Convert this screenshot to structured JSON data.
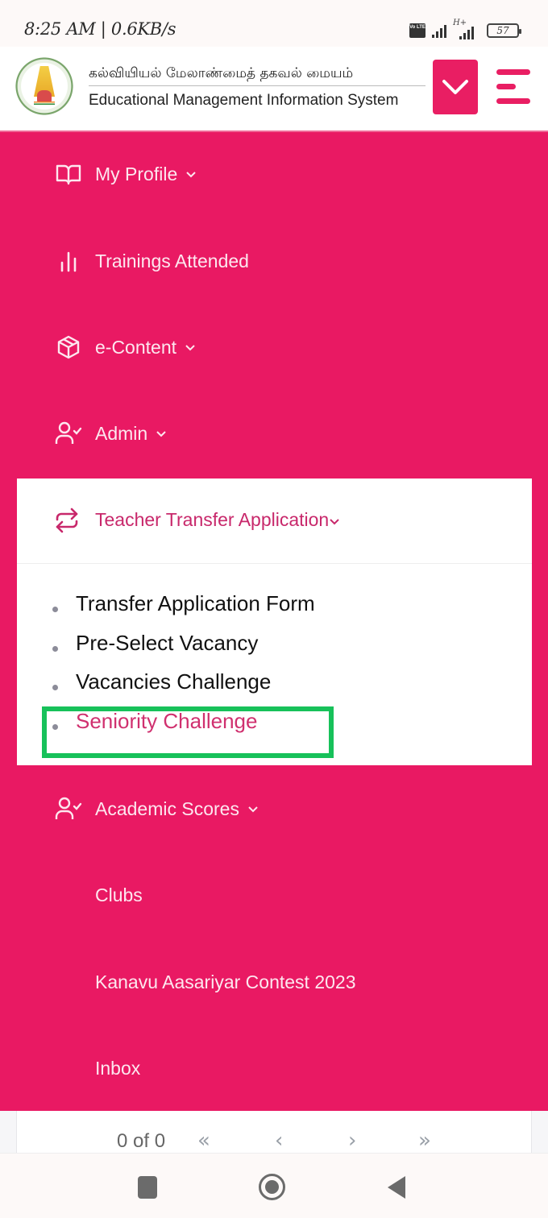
{
  "status_bar": {
    "time_speed": "8:25 AM | 0.6KB/s",
    "volte_label": "Vo LTE",
    "network_type": "H+",
    "battery_level": "57"
  },
  "header": {
    "logo_icon": "tamil-nadu-emblem",
    "title_tamil": "கல்வியியல் மேலாண்மைத் தகவல் மையம்",
    "title_english": "Educational Management Information System",
    "dropdown_icon": "chevron-down-icon",
    "menu_icon": "hamburger-icon"
  },
  "colors": {
    "brand_pink": "#e91963",
    "active_text": "#d0306f",
    "highlight_green": "#17c15a"
  },
  "menu": {
    "items": [
      {
        "label": "My Profile",
        "icon": "book-open-icon",
        "has_caret": true
      },
      {
        "label": "Trainings Attended",
        "icon": "bar-chart-icon",
        "has_caret": false
      },
      {
        "label": "e-Content",
        "icon": "package-icon",
        "has_caret": true
      },
      {
        "label": "Admin",
        "icon": "user-check-icon",
        "has_caret": true
      }
    ],
    "expanded": {
      "label": "Teacher Transfer Application",
      "icon": "repeat-icon",
      "has_caret": true,
      "children": [
        {
          "label": "Transfer Application Form",
          "active": false
        },
        {
          "label": "Pre-Select Vacancy",
          "active": false
        },
        {
          "label": "Vacancies Challenge",
          "active": false
        },
        {
          "label": "Seniority Challenge",
          "active": true
        }
      ]
    },
    "items_after": [
      {
        "label": "Academic Scores",
        "icon": "user-check-icon",
        "has_caret": true
      },
      {
        "label": "Clubs",
        "icon": "",
        "has_caret": false
      },
      {
        "label": "Kanavu Aasariyar Contest 2023",
        "icon": "",
        "has_caret": false
      },
      {
        "label": "Inbox",
        "icon": "",
        "has_caret": false
      }
    ]
  },
  "pagination": {
    "count_text": "0 of 0",
    "first": "«",
    "prev": "‹",
    "next": "›",
    "last": "»"
  },
  "nav_bar": {
    "recents": "recents-icon",
    "home": "home-icon",
    "back": "back-icon"
  }
}
